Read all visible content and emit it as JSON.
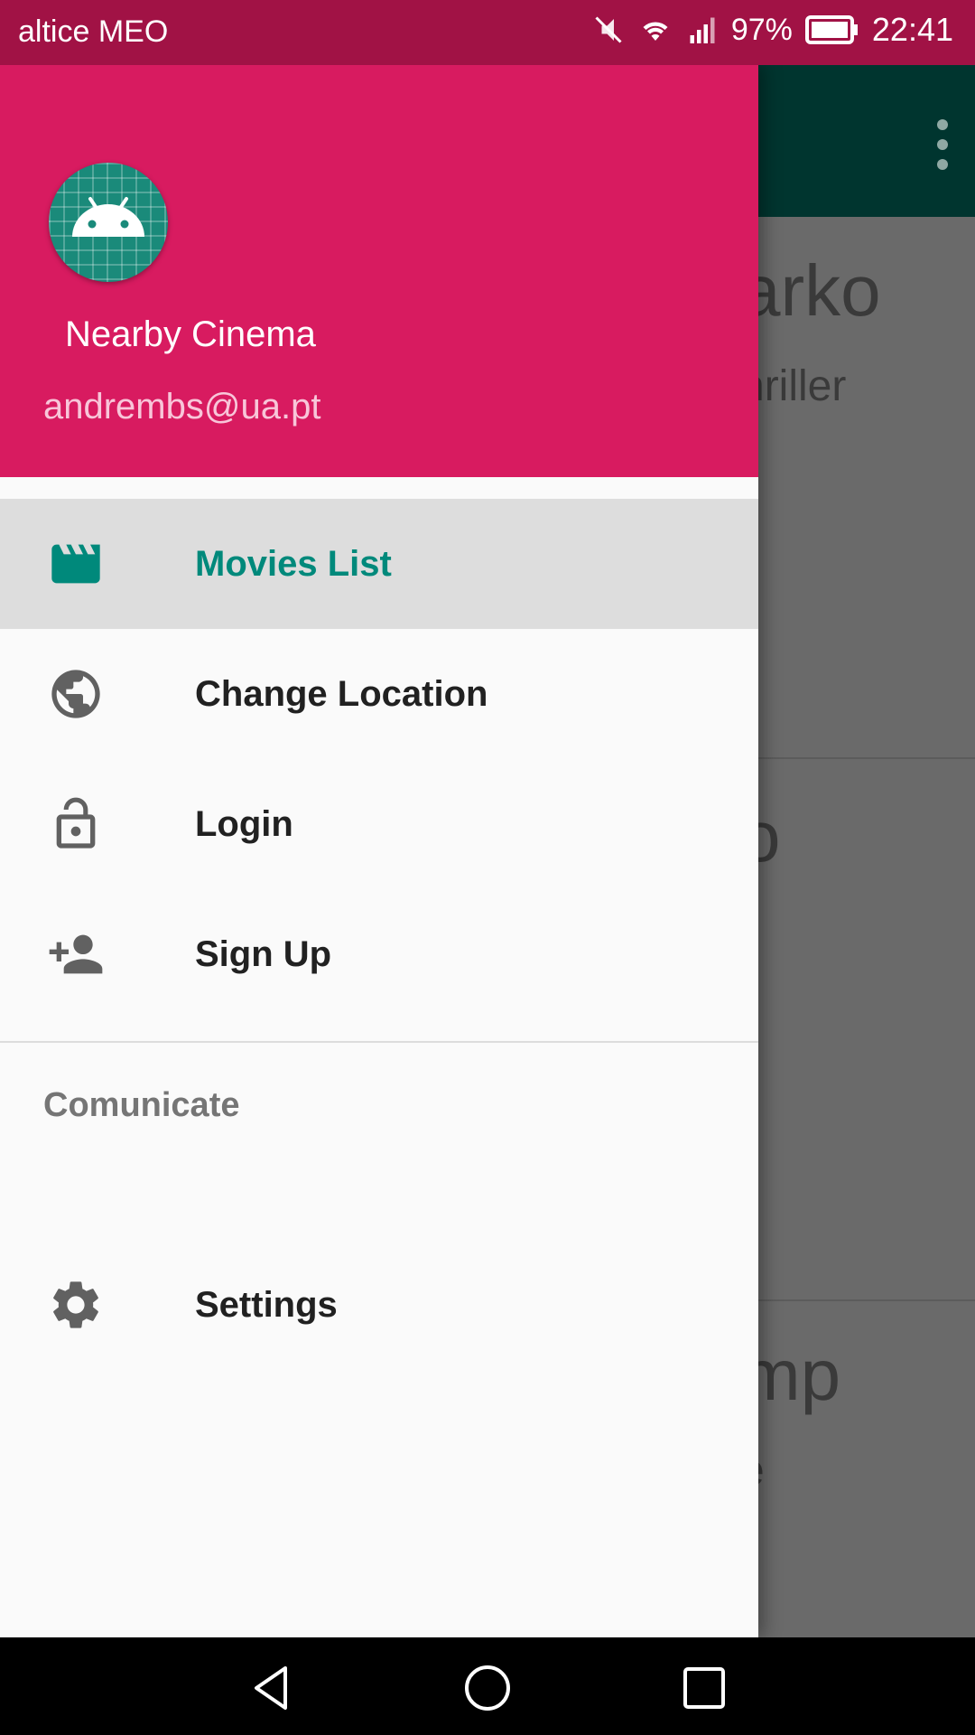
{
  "status_bar": {
    "carrier": "altice MEO",
    "battery": "97%",
    "time": "22:41",
    "icons": [
      "mute-icon",
      "wifi-icon",
      "signal-icon",
      "battery-icon"
    ]
  },
  "background": {
    "cards": [
      {
        "title": "arko",
        "subtitle": "hriller"
      },
      {
        "title": "o",
        "subtitle": ""
      },
      {
        "title": "mp",
        "subtitle": "e"
      }
    ]
  },
  "drawer": {
    "header": {
      "app_name": "Nearby Cinema",
      "email": "andrembs@ua.pt",
      "avatar_icon": "android-icon",
      "color": "#d81b60"
    },
    "items": [
      {
        "label": "Movies List",
        "icon": "movie-clapper-icon",
        "active": true
      },
      {
        "label": "Change Location",
        "icon": "globe-icon",
        "active": false
      },
      {
        "label": "Login",
        "icon": "lock-open-icon",
        "active": false
      },
      {
        "label": "Sign Up",
        "icon": "person-add-icon",
        "active": false
      }
    ],
    "section_title": "Comunicate",
    "section_items": [
      {
        "label": "Settings",
        "icon": "gear-icon"
      }
    ],
    "accent_color": "#00897b"
  },
  "nav_bar": {
    "buttons": [
      "back-icon",
      "home-icon",
      "recents-icon"
    ]
  }
}
